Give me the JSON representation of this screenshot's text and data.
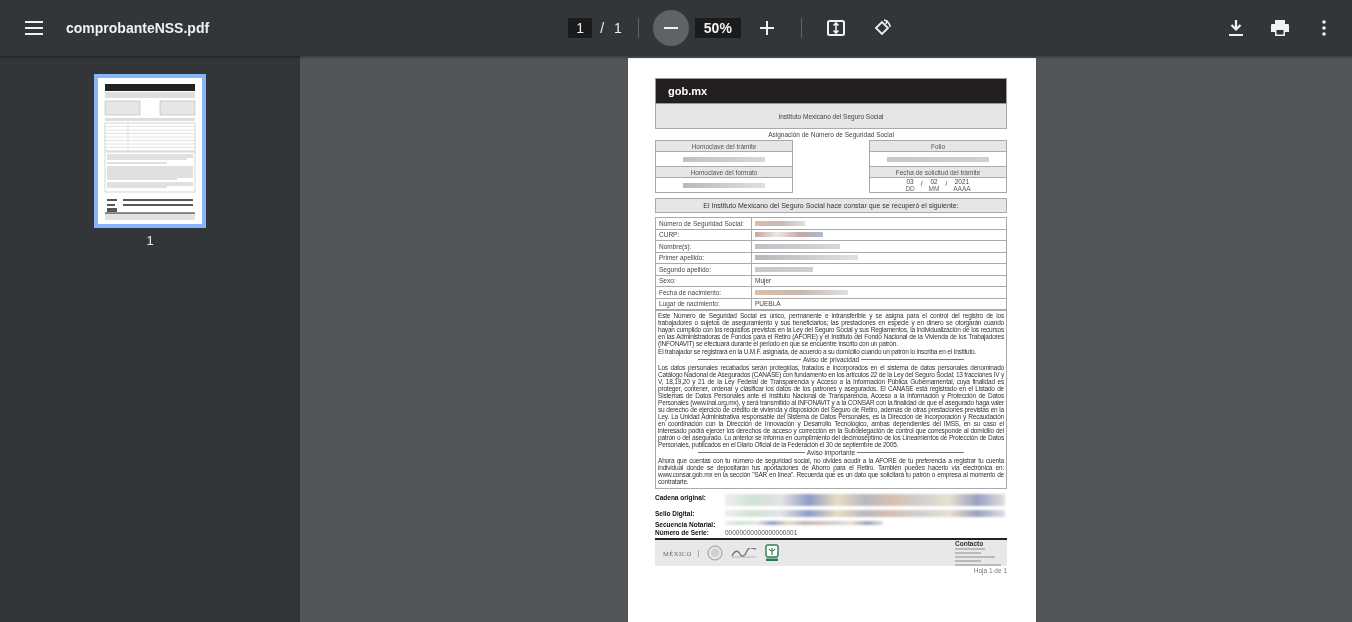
{
  "toolbar": {
    "file_name": "comprobanteNSS.pdf",
    "page": "1",
    "page_separator": "/",
    "page_count": "1",
    "zoom": "50%"
  },
  "thumbnails": [
    {
      "label": "1",
      "selected": true
    }
  ],
  "document": {
    "brand": "gob.mx",
    "header": "Instituto Mexicano del Seguro Social",
    "title": "Asignación de Número de Seguridad Social",
    "left_fields": [
      {
        "label": "Homoclave del trámite",
        "redacted": true
      },
      {
        "label": "Homoclave del formato",
        "redacted": true
      }
    ],
    "folio": {
      "label": "Folio",
      "redacted": true
    },
    "date": {
      "label": "Fecha de solicitud del trámite",
      "separator": "/",
      "parts": [
        {
          "value": "03",
          "unit": "DD"
        },
        {
          "value": "02",
          "unit": "MM"
        },
        {
          "value": "2021",
          "unit": "AAAA"
        }
      ]
    },
    "statement": "El Instituto Mexicano del Seguro Social hace constar que se recuperó el siguiente:",
    "rows": [
      {
        "label": "Número de Seguridad Social:",
        "redacted": true
      },
      {
        "label": "CURP:",
        "redacted": true
      },
      {
        "label": "Nombre(s):",
        "redacted": true
      },
      {
        "label": "Primer apellido:",
        "redacted": true
      },
      {
        "label": "Segundo apellido:",
        "redacted": true
      },
      {
        "label": "Sexo:",
        "redacted": false,
        "value": "Mujer"
      },
      {
        "label": "Fecha de nacimiento:",
        "redacted": true
      },
      {
        "label": "Lugar de nacimiento:",
        "redacted": false,
        "value": "PUEBLA"
      }
    ],
    "notice": [
      {
        "kind": "paragraph",
        "text": "Este Número de Seguridad Social es único, permanente e intransferible y se asigna para el control del registro de los trabajadores o sujetos de aseguramiento y sus beneficiarios; las prestaciones en especie y en dinero se otorgarán cuando hayan cumplido con los requisitos previstos en la Ley del Seguro Social y sus Reglamentos, la individualización de los recursos en las Administradoras de Fondos para el Retiro (AFORE) y el Instituto del Fondo Nacional de la Vivienda de los Trabajadores (INFONAVIT) se efectuará durante el periodo en que se encuentre inscrito con un patrón."
      },
      {
        "kind": "paragraph",
        "text": "El trabajador se registrará en la U.M.F. asignada, de acuerdo a su domicilio cuando un patrón lo inscriba en el Instituto."
      },
      {
        "kind": "heading",
        "text": "Aviso de privacidad"
      },
      {
        "kind": "paragraph",
        "text": "Los datos personales recabados serán protegidos, tratados e incorporados en el sistema de datos personales denominado Catálogo Nacional de Asegurados (CANASE) con fundamento en los artículos 22 de la Ley del Seguro Social; 13 fracciones IV y V, 18,19,20 y 21 de la Ley Federal de Transparencia y Acceso a la Información Pública Gubernamental, cuya finalidad es proteger, contener, ordenar y clasificar los datos de los patrones y asegurados. El CANASE está registrado en el Listado de Sistemas de Datos Personales ante el Instituto Nacional de Transparencia, Acceso a la Información y Protección de Datos Personales (www.inai.org.mx), y será transmitido al INFONAVIT y a la CONSAR con la finalidad de que el asegurado haga valer su derecho de ejercicio de crédito de vivienda y disposición del Seguro de Retiro, además de otras prestaciones previstas en la Ley. La Unidad Administrativa responsable del Sistema de Datos Personales, es la Dirección de Incorporación y Recaudación en coordinación con la Dirección de Innovación y Desarrollo Tecnológico, ambas dependientes del IMSS, en su caso el interesado podrá ejercer los derechos de acceso y corrección en la Subdelegación de control que corresponde al domicilio del patrón o del asegurado. Lo anterior se informa en cumplimiento del decimoséptimo de los Lineamientos de Protección de Datos Personales, publicados en el Diario Oficial de la Federación el 30 de septiembre de 2005."
      },
      {
        "kind": "heading",
        "text": "Aviso importante"
      },
      {
        "kind": "paragraph",
        "text": "Ahora que cuentas con tu número de seguridad social, no olvides acudir a la AFORE de tu preferencia a registrar tu cuenta individual donde se depositarán tus aportaciones de Ahorro para el Retiro. También puedes hacerlo vía electrónica en: www.consar.gob.mx en la sección \"SAR en línea\". Recuerda que es un dato que solicitará tu patrón o empresa al momento de contratarte."
      }
    ],
    "signatures": [
      {
        "label": "Cadena original:",
        "redacted": true
      },
      {
        "label": "Sello Digital:",
        "redacted": true
      },
      {
        "label": "Secuencia Notarial:",
        "redacted": true
      },
      {
        "label": "Número de Serie:",
        "redacted": false,
        "value": "00000000000000000001"
      }
    ],
    "footer": {
      "logo_text": "MÉXICO",
      "contact_title": "Contacto"
    },
    "page_footer": "Hoja 1 de 1"
  }
}
